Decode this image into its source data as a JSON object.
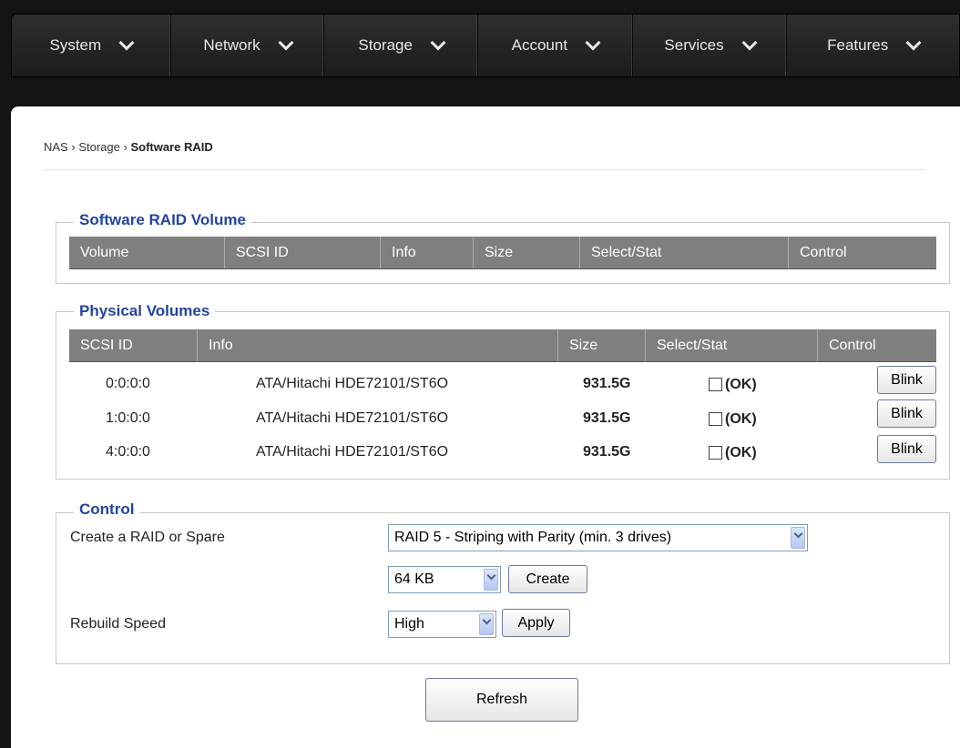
{
  "nav": {
    "items": [
      {
        "label": "System"
      },
      {
        "label": "Network"
      },
      {
        "label": "Storage"
      },
      {
        "label": "Account"
      },
      {
        "label": "Services"
      },
      {
        "label": "Features"
      }
    ]
  },
  "breadcrumb": {
    "root": "NAS",
    "section": "Storage",
    "current": "Software RAID",
    "separator": "›"
  },
  "raid_volume": {
    "title": "Software RAID Volume",
    "columns": [
      "Volume",
      "SCSI ID",
      "Info",
      "Size",
      "Select/Stat",
      "Control"
    ]
  },
  "physical": {
    "title": "Physical Volumes",
    "columns": [
      "SCSI ID",
      "Info",
      "Size",
      "Select/Stat",
      "Control"
    ],
    "rows": [
      {
        "scsi_id": "0:0:0:0",
        "info": "ATA/Hitachi HDE72101/ST6O",
        "size": "931.5G",
        "status": "(OK)",
        "button": "Blink"
      },
      {
        "scsi_id": "1:0:0:0",
        "info": "ATA/Hitachi HDE72101/ST6O",
        "size": "931.5G",
        "status": "(OK)",
        "button": "Blink"
      },
      {
        "scsi_id": "4:0:0:0",
        "info": "ATA/Hitachi HDE72101/ST6O",
        "size": "931.5G",
        "status": "(OK)",
        "button": "Blink"
      }
    ]
  },
  "control": {
    "title": "Control",
    "create_label": "Create a RAID or Spare",
    "raid_select": "RAID 5 - Striping with Parity (min. 3 drives)",
    "chunk_select": "64 KB",
    "create_button": "Create",
    "rebuild_label": "Rebuild Speed",
    "speed_select": "High",
    "apply_button": "Apply"
  },
  "refresh_button": "Refresh"
}
